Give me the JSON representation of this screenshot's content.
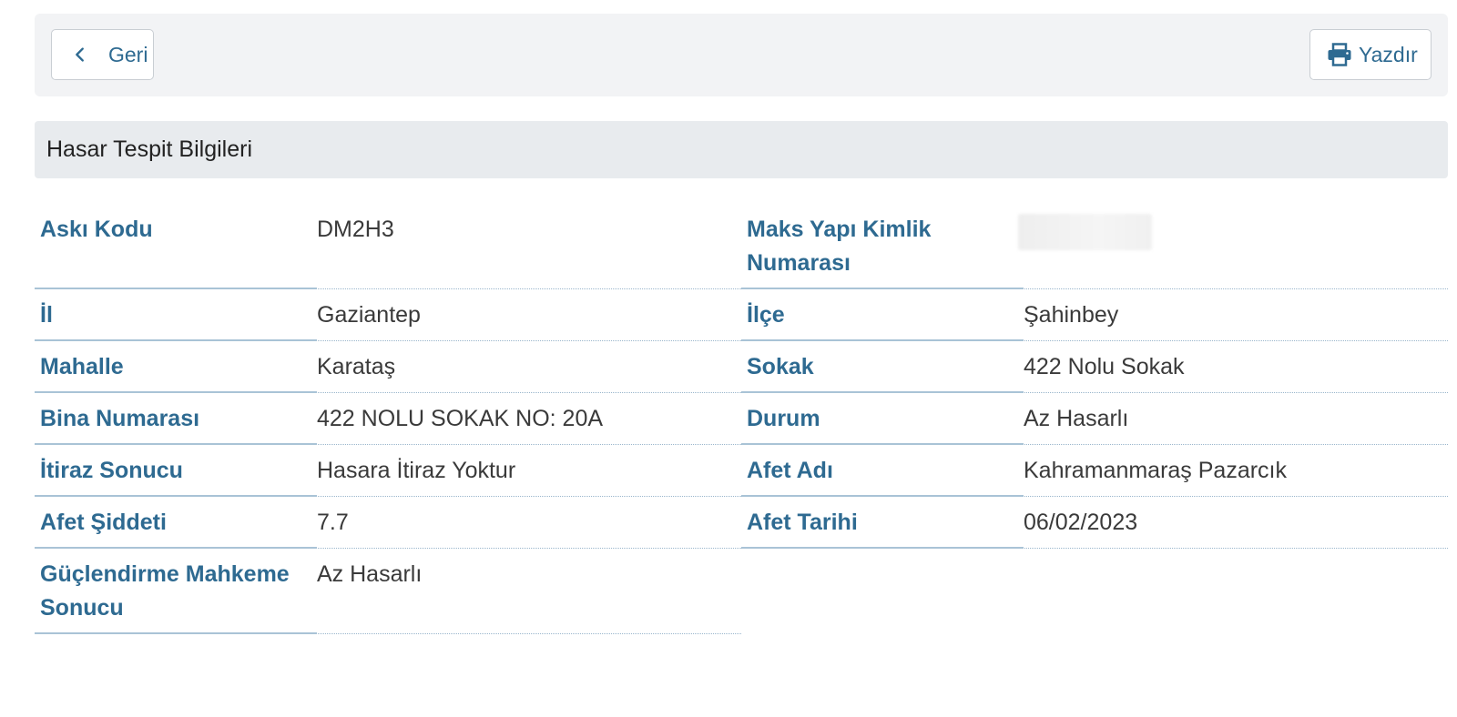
{
  "toolbar": {
    "back_label": "Geri",
    "print_label": "Yazdır",
    "back_icon": "chevron-left-icon",
    "print_icon": "printer-icon"
  },
  "section": {
    "title": "Hasar Tespit Bilgileri"
  },
  "fields": {
    "aski_kodu": {
      "label": "Askı Kodu",
      "value": "DM2H3"
    },
    "maks_yapi": {
      "label": "Maks Yapı Kimlik Numarası",
      "value": ""
    },
    "il": {
      "label": "İl",
      "value": "Gaziantep"
    },
    "ilce": {
      "label": "İlçe",
      "value": "Şahinbey"
    },
    "mahalle": {
      "label": "Mahalle",
      "value": "Karataş"
    },
    "sokak": {
      "label": "Sokak",
      "value": "422 Nolu Sokak"
    },
    "bina_numarasi": {
      "label": "Bina Numarası",
      "value": "422 NOLU SOKAK NO: 20A"
    },
    "durum": {
      "label": "Durum",
      "value": "Az Hasarlı"
    },
    "itiraz_sonucu": {
      "label": "İtiraz Sonucu",
      "value": "Hasara İtiraz Yoktur"
    },
    "afet_adi": {
      "label": "Afet Adı",
      "value": "Kahramanmaraş Pazarcık"
    },
    "afet_siddeti": {
      "label": "Afet Şiddeti",
      "value": "7.7"
    },
    "afet_tarihi": {
      "label": "Afet Tarihi",
      "value": "06/02/2023"
    },
    "guclendirme": {
      "label": "Güçlendirme Mahkeme Sonucu",
      "value": "Az Hasarlı"
    }
  },
  "colors": {
    "accent": "#2e6a91",
    "toolbar_bg": "#f2f3f5",
    "section_bg": "#e8ebee"
  }
}
